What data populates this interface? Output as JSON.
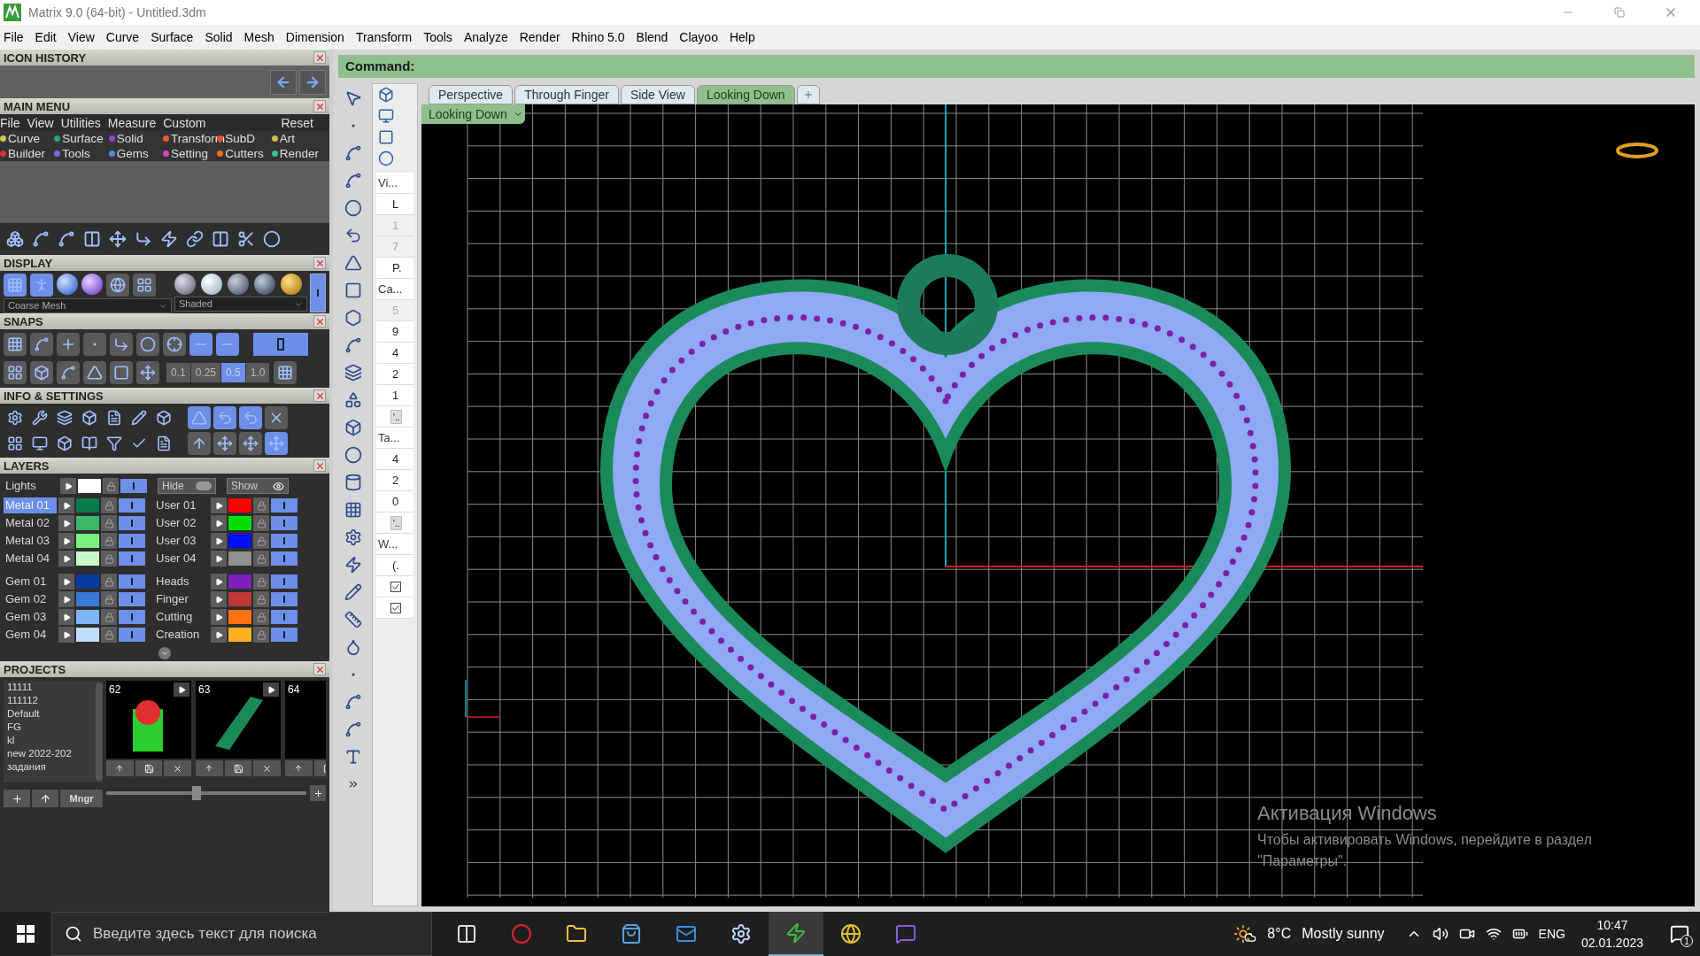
{
  "window": {
    "title": "Matrix 9.0 (64-bit) - Untitled.3dm"
  },
  "menu_bar": [
    "File",
    "Edit",
    "View",
    "Curve",
    "Surface",
    "Solid",
    "Mesh",
    "Dimension",
    "Transform",
    "Tools",
    "Analyze",
    "Render",
    "Rhino 5.0",
    "Blend",
    "Clayoo",
    "Help"
  ],
  "icon_history": {
    "title": "ICON HISTORY"
  },
  "main_menu": {
    "title": "MAIN MENU",
    "items": [
      "File",
      "View",
      "Utilities",
      "Measure",
      "Custom"
    ],
    "reset": "Reset",
    "categories": [
      {
        "label": "Curve",
        "color": "#d4c24a"
      },
      {
        "label": "Surface",
        "color": "#2fa07a"
      },
      {
        "label": "Solid",
        "color": "#9040e0"
      },
      {
        "label": "Transform",
        "color": "#f05a28"
      },
      {
        "label": "SubD",
        "color": "#f04a28"
      },
      {
        "label": "Art",
        "color": "#c8c040"
      },
      {
        "label": "Builder",
        "color": "#e03030"
      },
      {
        "label": "Tools",
        "color": "#7070e0"
      },
      {
        "label": "Gems",
        "color": "#4090e0"
      },
      {
        "label": "Setting",
        "color": "#e040c0"
      },
      {
        "label": "Cutters",
        "color": "#f07020"
      },
      {
        "label": "Render",
        "color": "#30c0a0"
      }
    ]
  },
  "display": {
    "title": "DISPLAY",
    "mesh": "Coarse Mesh",
    "shading": "Shaded"
  },
  "snaps": {
    "title": "SNAPS",
    "increments": [
      {
        "label": "0.1",
        "selected": false
      },
      {
        "label": "0.25",
        "selected": false
      },
      {
        "label": "0.5",
        "selected": true
      },
      {
        "label": "1.0",
        "selected": false
      }
    ]
  },
  "info_settings": {
    "title": "INFO & SETTINGS"
  },
  "layers": {
    "title": "LAYERS",
    "lights": {
      "name": "Lights",
      "color": "#ffffff",
      "visible": true
    },
    "hide": "Hide",
    "show": "Show",
    "left": [
      {
        "name": "Metal 01",
        "color": "#0e7a50",
        "selected": true,
        "visible": true
      },
      {
        "name": "Metal 02",
        "color": "#3cb86a",
        "selected": false,
        "visible": true
      },
      {
        "name": "Metal 03",
        "color": "#7cf07c",
        "selected": false,
        "visible": true
      },
      {
        "name": "Metal 04",
        "color": "#c8f8c8",
        "selected": false,
        "visible": true
      },
      {
        "name": "Gem 01",
        "color": "#0a3aa0",
        "selected": false,
        "visible": true
      },
      {
        "name": "Gem 02",
        "color": "#3a78d8",
        "selected": false,
        "visible": true
      },
      {
        "name": "Gem 03",
        "color": "#80b4f8",
        "selected": false,
        "visible": true
      },
      {
        "name": "Gem 04",
        "color": "#c0dcff",
        "selected": false,
        "visible": true
      }
    ],
    "right": [
      {
        "name": "User 01",
        "color": "#ff0000",
        "selected": false,
        "visible": true
      },
      {
        "name": "User 02",
        "color": "#00e000",
        "selected": false,
        "visible": true
      },
      {
        "name": "User 03",
        "color": "#0010f0",
        "selected": false,
        "visible": true
      },
      {
        "name": "User 04",
        "color": "#909090",
        "selected": false,
        "visible": true
      },
      {
        "name": "Heads",
        "color": "#8020c0",
        "selected": false,
        "visible": true
      },
      {
        "name": "Finger",
        "color": "#c03838",
        "selected": false,
        "visible": true
      },
      {
        "name": "Cutting",
        "color": "#ff7010",
        "selected": false,
        "visible": true
      },
      {
        "name": "Creation",
        "color": "#ffb020",
        "selected": false,
        "visible": true
      }
    ]
  },
  "projects": {
    "title": "PROJECTS",
    "list": [
      "11111",
      "111112",
      "Default",
      "FG",
      "kl",
      "new 2022-202",
      "задания"
    ],
    "thumbnails": [
      "62",
      "63",
      "64"
    ],
    "manager": "Mngr",
    "thumbnail_size": {
      "level": 0.45
    }
  },
  "command": {
    "label": "Command:"
  },
  "view_tabs": [
    {
      "label": "Perspective",
      "selected": false
    },
    {
      "label": "Through Finger",
      "selected": false
    },
    {
      "label": "Side View",
      "selected": false
    },
    {
      "label": "Looking Down",
      "selected": true
    }
  ],
  "viewport": {
    "label": "Looking Down"
  },
  "properties": [
    {
      "kind": "header",
      "text": "Vi..."
    },
    {
      "kind": "value",
      "text": "L",
      "disabled": false
    },
    {
      "kind": "value",
      "text": "1",
      "disabled": true
    },
    {
      "kind": "value",
      "text": "7",
      "disabled": true
    },
    {
      "kind": "value",
      "text": "P.",
      "disabled": false
    },
    {
      "kind": "header",
      "text": "Ca..."
    },
    {
      "kind": "value",
      "text": "5",
      "disabled": true
    },
    {
      "kind": "value",
      "text": "9",
      "disabled": false
    },
    {
      "kind": "value",
      "text": "4",
      "disabled": false
    },
    {
      "kind": "value",
      "text": "2",
      "disabled": false
    },
    {
      "kind": "value",
      "text": "1",
      "disabled": false
    },
    {
      "kind": "button",
      "text": "'.."
    },
    {
      "kind": "header",
      "text": "Ta..."
    },
    {
      "kind": "value",
      "text": "4",
      "disabled": false
    },
    {
      "kind": "value",
      "text": "2",
      "disabled": false
    },
    {
      "kind": "value",
      "text": "0",
      "disabled": false
    },
    {
      "kind": "button",
      "text": "'.."
    },
    {
      "kind": "header",
      "text": "W..."
    },
    {
      "kind": "value",
      "text": "(.",
      "disabled": false
    },
    {
      "kind": "check",
      "checked": true
    },
    {
      "kind": "check",
      "checked": true
    }
  ],
  "taskbar": {
    "search_placeholder": "Введите здесь текст для поиска",
    "temperature": "8°C",
    "weather": "Mostly sunny",
    "language": "ENG",
    "time": "10:47",
    "date": "02.01.2023",
    "notifications": "1"
  },
  "activation": {
    "title": "Активация Windows",
    "text": "Чтобы активировать Windows, перейдите в раздел \"Параметры\"."
  }
}
